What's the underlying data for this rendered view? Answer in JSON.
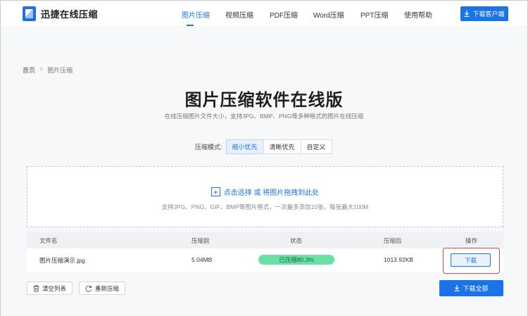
{
  "header": {
    "logo_text": "迅捷在线压缩",
    "nav": [
      {
        "label": "图片压缩",
        "active": true
      },
      {
        "label": "视频压缩",
        "active": false
      },
      {
        "label": "PDF压缩",
        "active": false
      },
      {
        "label": "Word压缩",
        "active": false
      },
      {
        "label": "PPT压缩",
        "active": false
      },
      {
        "label": "使用帮助",
        "active": false
      }
    ],
    "download_client_label": "下载客户端",
    "accent_color": "#1a73e8"
  },
  "breadcrumb": {
    "home": "首页",
    "separator": ">",
    "current": "图片压缩"
  },
  "page": {
    "title": "图片压缩软件在线版",
    "subtitle": "在线压缩图片文件大小，支持JPG、BMP、PNG等多种格式的图片在线压缩"
  },
  "compression_mode": {
    "label": "压缩模式:",
    "options": [
      {
        "label": "缩小优先",
        "selected": true
      },
      {
        "label": "清晰优先",
        "selected": false
      },
      {
        "label": "自定义",
        "selected": false
      }
    ]
  },
  "upload": {
    "prompt": "点击选择 或 将图片拖拽到此处",
    "hint": "支持JPG、PNG、GIF、BMP等图片格式，一次最多添加10张，每张最大100M"
  },
  "table": {
    "headers": [
      "文件名",
      "压缩前",
      "状态",
      "压缩后",
      "操作"
    ],
    "rows": [
      {
        "filename": "图片压缩演示.jpg",
        "before": "5.04MB",
        "status": "已压缩80.3%",
        "after": "1013.92KB",
        "action": "下载"
      }
    ],
    "status_color": "#6be0a5",
    "highlight_color": "#e0463a"
  },
  "footer": {
    "clear_label": "清空列表",
    "recompress_label": "重新压缩",
    "download_all_label": "下载全部"
  }
}
